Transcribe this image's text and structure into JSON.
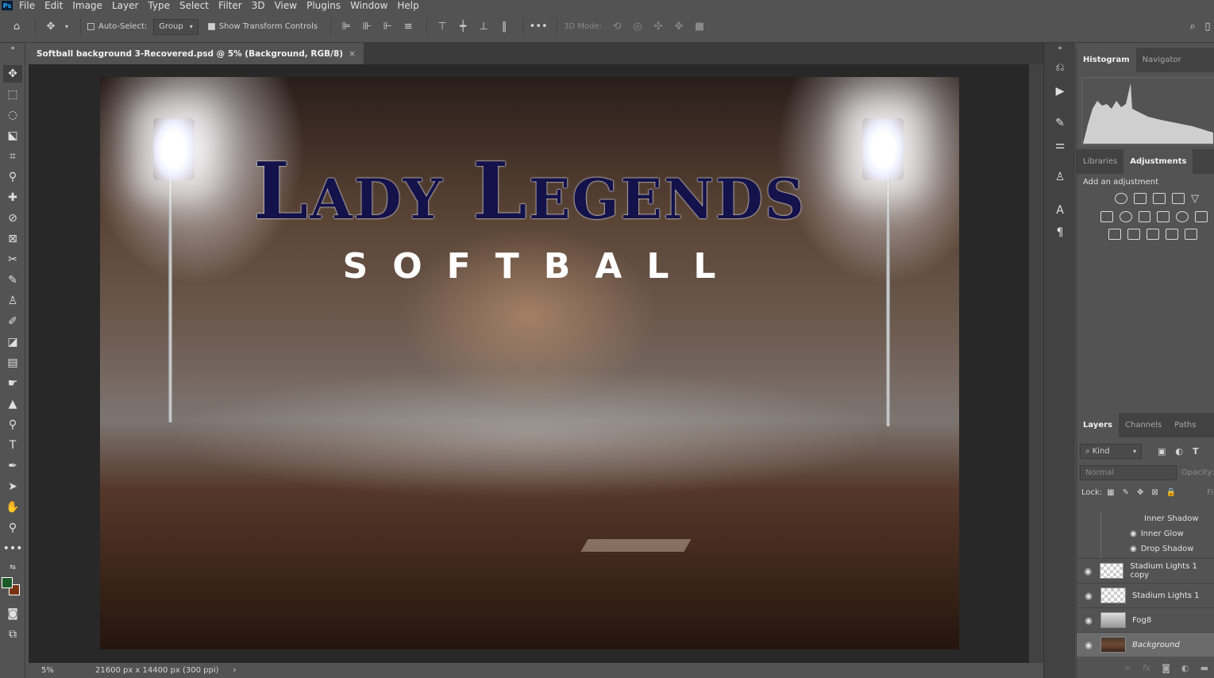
{
  "menu": [
    "File",
    "Edit",
    "Image",
    "Layer",
    "Type",
    "Select",
    "Filter",
    "3D",
    "View",
    "Plugins",
    "Window",
    "Help"
  ],
  "app_logo": "Ps",
  "options": {
    "auto_select_label": "Auto-Select:",
    "auto_select_value": "Group",
    "show_transform_label": "Show Transform Controls",
    "mode_3d_label": "3D Mode:"
  },
  "document": {
    "tab_title": "Softball background 3-Recovered.psd @ 5% (Background, RGB/8)",
    "close": "×"
  },
  "canvas": {
    "title": "Lady Legends",
    "subtitle": "SOFTBALL"
  },
  "status": {
    "zoom": "5%",
    "dimensions": "21600 px x 14400 px (300 ppi)",
    "arrow": "›"
  },
  "panels": {
    "top_tabs": [
      "Histogram",
      "Navigator"
    ],
    "mid_tabs": [
      "Libraries",
      "Adjustments"
    ],
    "adjustment_hint": "Add an adjustment",
    "layer_tabs": [
      "Layers",
      "Channels",
      "Paths"
    ],
    "kind_filter": "Kind",
    "blend_mode": "Normal",
    "opacity_label": "Opacity:",
    "lock_label": "Lock:",
    "fill_label": "Fill:",
    "effects": [
      "Inner Shadow",
      "Inner Glow",
      "Drop Shadow"
    ],
    "layers": [
      "Stadium Lights 1 copy",
      "Stadium Lights 1",
      "Fog8",
      "Background"
    ]
  },
  "colors": {
    "foreground": "#1d5a2a",
    "background": "#7a3312",
    "title_navy": "#14124a"
  }
}
